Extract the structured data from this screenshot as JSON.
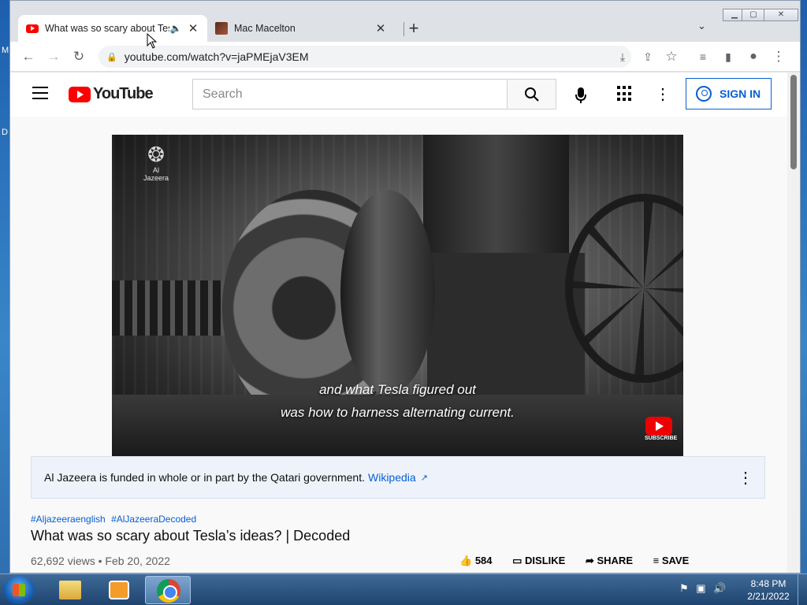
{
  "browser": {
    "tabs": [
      {
        "title": "What was so scary about Tes",
        "favicon": "youtube-icon",
        "active": true,
        "audio": true
      },
      {
        "title": "Mac Macelton",
        "favicon": "avatar-icon",
        "active": false
      }
    ],
    "new_tab_glyph": "+",
    "url": "youtube.com/watch?v=jaPMEjaV3EM"
  },
  "youtube": {
    "logo_text": "YouTube",
    "search_placeholder": "Search",
    "sign_in_label": "SIGN IN",
    "video": {
      "watermark": "Al Jazeera",
      "caption_lines": [
        "and what Tesla figured out",
        "was how to harness alternating current."
      ],
      "subscribe_label": "SUBSCRIBE"
    },
    "info_panel": {
      "text": "Al Jazeera is funded in whole or in part by the Qatari government.",
      "link": "Wikipedia"
    },
    "hashtags": [
      "#Aljazeeraenglish",
      "#AlJazeeraDecoded"
    ],
    "title": "What was so scary about Tesla’s ideas? | Decoded",
    "meta": "62,692 views • Feb 20, 2022",
    "actions": {
      "likes": "584",
      "dislike": "DISLIKE",
      "share": "SHARE",
      "save": "SAVE"
    }
  },
  "taskbar": {
    "clock_time": "8:48 PM",
    "clock_date": "2/21/2022"
  },
  "colors": {
    "youtube_red": "#ff0000",
    "link_blue": "#065fd4",
    "taskbar": "#1f4470"
  }
}
